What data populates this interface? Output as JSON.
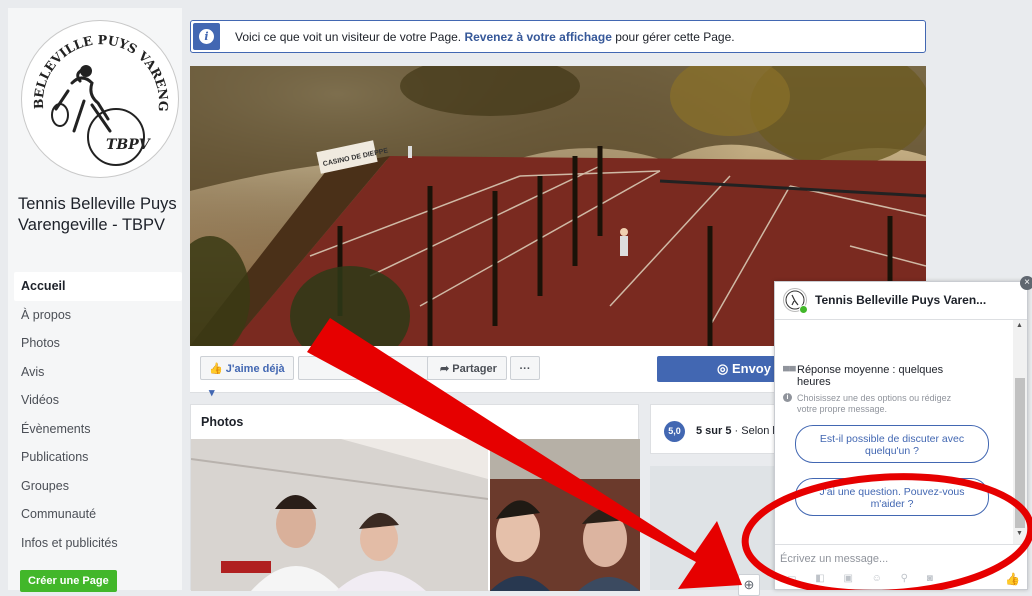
{
  "sidebar": {
    "logo_text": "BELLEVILLE PUYS VARENGEVILLE",
    "logo_badge": "TBPV",
    "page_name": "Tennis Belleville Puys Varengeville - TBPV",
    "nav": [
      "Accueil",
      "À propos",
      "Photos",
      "Avis",
      "Vidéos",
      "Évènements",
      "Publications",
      "Groupes",
      "Communauté",
      "Infos et publicités"
    ],
    "create_page": "Créer une Page"
  },
  "banner": {
    "icon": "info-icon",
    "text_before": "Voici ce que voit un visiteur de votre Page. ",
    "link": "Revenez à votre affichage",
    "text_after": " pour gérer cette Page."
  },
  "cover": {
    "sign_text": "CASINO DE DIEPPE"
  },
  "actions": {
    "like": "J'aime déjà",
    "follow": "",
    "share": "Partager",
    "more": "···",
    "send": "Envoy"
  },
  "photos": {
    "title": "Photos"
  },
  "rating": {
    "badge": "5,0",
    "text_bold": "5 sur 5",
    "text_rest": " · Selon l"
  },
  "chat": {
    "title": "Tennis Belleville Puys Varen...",
    "close": "×",
    "response": "Réponse moyenne : quelques heures",
    "choose": "Choisissez une des options ou rédigez votre propre message.",
    "quick_replies": [
      "Est-il possible de discuter avec quelqu'un ?",
      "J'ai une question. Pouvez-vous m'aider ?"
    ],
    "input_placeholder": "Écrivez un message..."
  },
  "colors": {
    "facebook_blue": "#4267b2",
    "annotation_red": "#e60000",
    "green": "#42b72a"
  }
}
